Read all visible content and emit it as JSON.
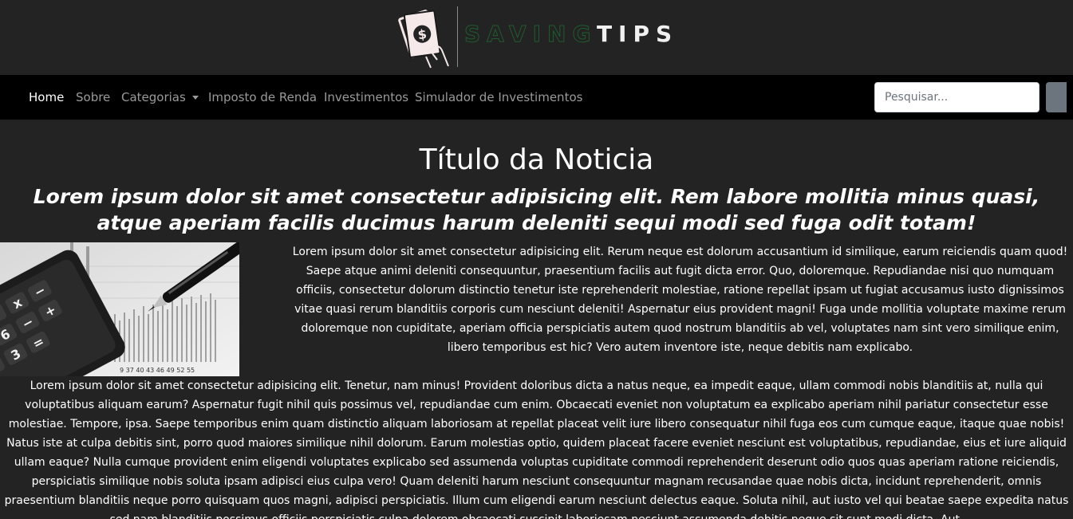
{
  "logo": {
    "saving": "SAVING",
    "tips": "TIPS",
    "icon": "money-hand-icon"
  },
  "nav": {
    "items": [
      {
        "label": "Home",
        "active": true
      },
      {
        "label": "Sobre"
      },
      {
        "label": "Categorias",
        "dropdown": true
      },
      {
        "label": "Imposto de Renda"
      },
      {
        "label": "Investimentos"
      },
      {
        "label": "Simulador de Investimentos"
      }
    ],
    "search_placeholder": "Pesquisar..."
  },
  "article": {
    "title": "Título da Noticia",
    "subtitle": "Lorem ipsum dolor sit amet consectetur adipisicing elit. Rem labore mollitia minus quasi, atque aperiam facilis ducimus harum deleniti sequi modi sed fuga odit totam!",
    "image": "calculator-pen-chart-image",
    "paragraphs": [
      "Lorem ipsum dolor sit amet consectetur adipisicing elit. Rerum neque est dolorum accusantium id similique, earum reiciendis quam quod! Saepe atque animi deleniti consequuntur, praesentium facilis aut fugit dicta error. Quo, doloremque. Repudiandae nisi quo numquam officiis, consectetur dolorum distinctio tenetur iste reprehenderit molestiae, ratione repellat ipsam ut fugiat accusamus iusto dignissimos vitae quasi rerum blanditiis corporis cum nesciunt deleniti! Aspernatur eius provident magni! Fuga unde mollitia voluptate maxime rerum doloremque non cupiditate, aperiam officia perspiciatis autem quod nostrum blanditiis ab vel, voluptates nam sint vero similique enim, libero temporibus est hic? Vero autem inventore iste, neque debitis nam explicabo.",
      "Lorem ipsum dolor sit amet consectetur adipisicing elit. Tenetur, nam minus! Provident doloribus dicta a natus neque, ea impedit eaque, ullam commodi nobis blanditiis at, nulla qui voluptatibus aliquam earum? Aspernatur fugit nihil quis possimus vel, repudiandae cum enim. Obcaecati eveniet non voluptatum ea explicabo aperiam nihil pariatur consectetur esse molestiae. Tempore, ipsa. Saepe temporibus enim quam distinctio aliquam laboriosam at repellat placeat velit iure libero consequatur nihil fuga eos cum cumque eaque, itaque quae nobis! Natus iste at culpa debitis sint, porro quod maiores similique nihil dolorum. Earum molestias optio, quidem placeat facere eveniet nesciunt est voluptatibus, repudiandae, eius et iure aliquid ullam eaque? Nulla cumque provident enim eligendi voluptates explicabo sed assumenda voluptas cupiditate commodi reprehenderit deserunt odio quos quas aperiam ratione reiciendis, perspiciatis similique nobis soluta ipsam adipisci eius culpa vero! Quam deleniti harum nesciunt consequuntur magnam recusandae quae nobis dicta, incidunt reprehenderit, omnis praesentium blanditiis neque porro quisquam quos magni, adipisci perspiciatis. Illum cum eligendi earum nesciunt delectus eaque. Soluta nihil, aut iusto vel qui beatae saepe expedita natus sed nam blanditiis possimus officiis perspiciatis culpa dolorem obcaecati suscipit laboriosam nesciunt assumenda debitis neque sit sunt modi dicta. Aut,"
    ],
    "image_numbers": "9  37  40  43  46  49  52  55"
  },
  "colors": {
    "background": "#232323",
    "navbar": "#000000",
    "logo_green": "#1f5d2e",
    "button_gray": "#6c757d"
  }
}
